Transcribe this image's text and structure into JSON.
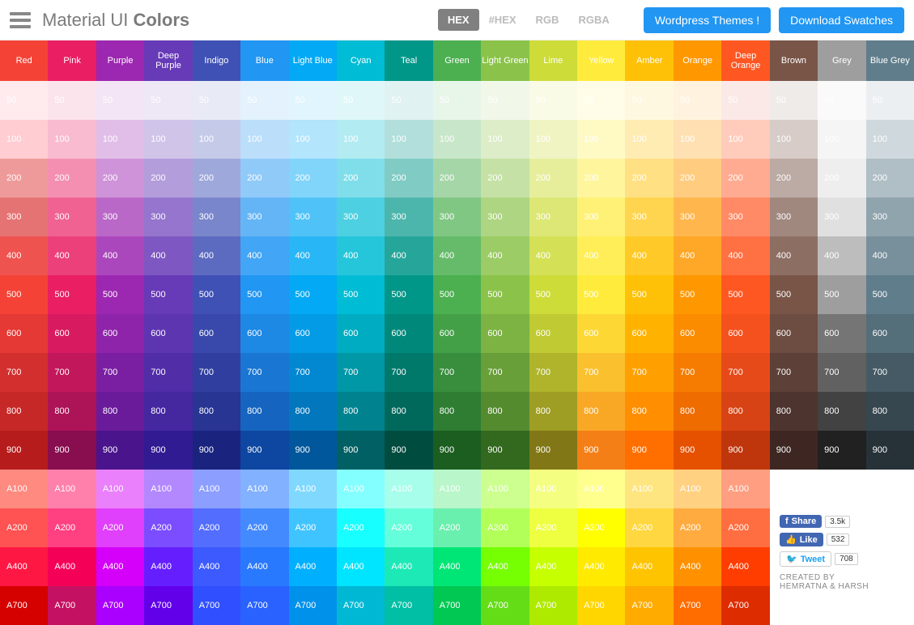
{
  "header": {
    "title_light": "Material UI ",
    "title_bold": "Colors",
    "formats": [
      "HEX",
      "#HEX",
      "RGB",
      "RGBA"
    ],
    "active_format": 0,
    "btn_themes": "Wordpress Themes !",
    "btn_download": "Download Swatches"
  },
  "shades": [
    "50",
    "100",
    "200",
    "300",
    "400",
    "500",
    "600",
    "700",
    "800",
    "900",
    "A100",
    "A200",
    "A400",
    "A700"
  ],
  "colors": [
    {
      "name": "Red",
      "swatches": [
        "#ffebee",
        "#ffcdd2",
        "#ef9a9a",
        "#e57373",
        "#ef5350",
        "#f44336",
        "#e53935",
        "#d32f2f",
        "#c62828",
        "#b71c1c",
        "#ff8a80",
        "#ff5252",
        "#ff1744",
        "#d50000"
      ]
    },
    {
      "name": "Pink",
      "swatches": [
        "#fce4ec",
        "#f8bbd0",
        "#f48fb1",
        "#f06292",
        "#ec407a",
        "#e91e63",
        "#d81b60",
        "#c2185b",
        "#ad1457",
        "#880e4f",
        "#ff80ab",
        "#ff4081",
        "#f50057",
        "#c51162"
      ]
    },
    {
      "name": "Purple",
      "swatches": [
        "#f3e5f5",
        "#e1bee7",
        "#ce93d8",
        "#ba68c8",
        "#ab47bc",
        "#9c27b0",
        "#8e24aa",
        "#7b1fa2",
        "#6a1b9a",
        "#4a148c",
        "#ea80fc",
        "#e040fb",
        "#d500f9",
        "#aa00ff"
      ]
    },
    {
      "name": "Deep Purple",
      "swatches": [
        "#ede7f6",
        "#d1c4e9",
        "#b39ddb",
        "#9575cd",
        "#7e57c2",
        "#673ab7",
        "#5e35b1",
        "#512da8",
        "#4527a0",
        "#311b92",
        "#b388ff",
        "#7c4dff",
        "#651fff",
        "#6200ea"
      ]
    },
    {
      "name": "Indigo",
      "swatches": [
        "#e8eaf6",
        "#c5cae9",
        "#9fa8da",
        "#7986cb",
        "#5c6bc0",
        "#3f51b5",
        "#3949ab",
        "#303f9f",
        "#283593",
        "#1a237e",
        "#8c9eff",
        "#536dfe",
        "#3d5afe",
        "#304ffe"
      ]
    },
    {
      "name": "Blue",
      "swatches": [
        "#e3f2fd",
        "#bbdefb",
        "#90caf9",
        "#64b5f6",
        "#42a5f5",
        "#2196f3",
        "#1e88e5",
        "#1976d2",
        "#1565c0",
        "#0d47a1",
        "#82b1ff",
        "#448aff",
        "#2979ff",
        "#2962ff"
      ]
    },
    {
      "name": "Light Blue",
      "swatches": [
        "#e1f5fe",
        "#b3e5fc",
        "#81d4fa",
        "#4fc3f7",
        "#29b6f6",
        "#03a9f4",
        "#039be5",
        "#0288d1",
        "#0277bd",
        "#01579b",
        "#80d8ff",
        "#40c4ff",
        "#00b0ff",
        "#0091ea"
      ]
    },
    {
      "name": "Cyan",
      "swatches": [
        "#e0f7fa",
        "#b2ebf2",
        "#80deea",
        "#4dd0e1",
        "#26c6da",
        "#00bcd4",
        "#00acc1",
        "#0097a7",
        "#00838f",
        "#006064",
        "#84ffff",
        "#18ffff",
        "#00e5ff",
        "#00b8d4"
      ]
    },
    {
      "name": "Teal",
      "swatches": [
        "#e0f2f1",
        "#b2dfdb",
        "#80cbc4",
        "#4db6ac",
        "#26a69a",
        "#009688",
        "#00897b",
        "#00796b",
        "#00695c",
        "#004d40",
        "#a7ffeb",
        "#64ffda",
        "#1de9b6",
        "#00bfa5"
      ]
    },
    {
      "name": "Green",
      "swatches": [
        "#e8f5e9",
        "#c8e6c9",
        "#a5d6a7",
        "#81c784",
        "#66bb6a",
        "#4caf50",
        "#43a047",
        "#388e3c",
        "#2e7d32",
        "#1b5e20",
        "#b9f6ca",
        "#69f0ae",
        "#00e676",
        "#00c853"
      ]
    },
    {
      "name": "Light Green",
      "swatches": [
        "#f1f8e9",
        "#dcedc8",
        "#c5e1a5",
        "#aed581",
        "#9ccc65",
        "#8bc34a",
        "#7cb342",
        "#689f38",
        "#558b2f",
        "#33691e",
        "#ccff90",
        "#b2ff59",
        "#76ff03",
        "#64dd17"
      ]
    },
    {
      "name": "Lime",
      "swatches": [
        "#f9fbe7",
        "#f0f4c3",
        "#e6ee9c",
        "#dce775",
        "#d4e157",
        "#cddc39",
        "#c0ca33",
        "#afb42b",
        "#9e9d24",
        "#827717",
        "#f4ff81",
        "#eeff41",
        "#c6ff00",
        "#aeea00"
      ]
    },
    {
      "name": "Yellow",
      "swatches": [
        "#fffde7",
        "#fff9c4",
        "#fff59d",
        "#fff176",
        "#ffee58",
        "#ffeb3b",
        "#fdd835",
        "#fbc02d",
        "#f9a825",
        "#f57f17",
        "#ffff8d",
        "#ffff00",
        "#ffea00",
        "#ffd600"
      ]
    },
    {
      "name": "Amber",
      "swatches": [
        "#fff8e1",
        "#ffecb3",
        "#ffe082",
        "#ffd54f",
        "#ffca28",
        "#ffc107",
        "#ffb300",
        "#ffa000",
        "#ff8f00",
        "#ff6f00",
        "#ffe57f",
        "#ffd740",
        "#ffc400",
        "#ffab00"
      ]
    },
    {
      "name": "Orange",
      "swatches": [
        "#fff3e0",
        "#ffe0b2",
        "#ffcc80",
        "#ffb74d",
        "#ffa726",
        "#ff9800",
        "#fb8c00",
        "#f57c00",
        "#ef6c00",
        "#e65100",
        "#ffd180",
        "#ffab40",
        "#ff9100",
        "#ff6d00"
      ]
    },
    {
      "name": "Deep Orange",
      "swatches": [
        "#fbe9e7",
        "#ffccbc",
        "#ffab91",
        "#ff8a65",
        "#ff7043",
        "#ff5722",
        "#f4511e",
        "#e64a19",
        "#d84315",
        "#bf360c",
        "#ff9e80",
        "#ff6e40",
        "#ff3d00",
        "#dd2c00"
      ]
    },
    {
      "name": "Brown",
      "swatches": [
        "#efebe9",
        "#d7ccc8",
        "#bcaaa4",
        "#a1887f",
        "#8d6e63",
        "#795548",
        "#6d4c41",
        "#5d4037",
        "#4e342e",
        "#3e2723"
      ]
    },
    {
      "name": "Grey",
      "swatches": [
        "#fafafa",
        "#f5f5f5",
        "#eeeeee",
        "#e0e0e0",
        "#bdbdbd",
        "#9e9e9e",
        "#757575",
        "#616161",
        "#424242",
        "#212121"
      ]
    },
    {
      "name": "Blue Grey",
      "swatches": [
        "#eceff1",
        "#cfd8dc",
        "#b0bec5",
        "#90a4ae",
        "#78909c",
        "#607d8b",
        "#546e7a",
        "#455a64",
        "#37474f",
        "#263238"
      ]
    }
  ],
  "social": {
    "share_label": "Share",
    "share_count": "3.5k",
    "like_label": "Like",
    "like_count": "532",
    "tweet_label": "Tweet",
    "tweet_count": "708"
  },
  "credit_line1": "CREATED BY",
  "credit_line2": "HEMRATNA & HARSH"
}
